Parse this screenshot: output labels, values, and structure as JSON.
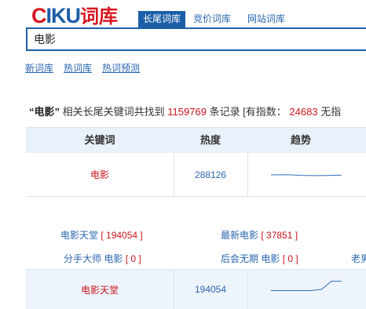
{
  "logo": {
    "c": "C",
    "rest": "IKU",
    "cn": "词库"
  },
  "tabs": [
    {
      "label": "长尾词库",
      "active": true
    },
    {
      "label": "竞价词库",
      "active": false
    },
    {
      "label": "网站词库",
      "active": false
    }
  ],
  "search": {
    "value": "电影"
  },
  "links": [
    "新词库",
    "热词库",
    "热词预测"
  ],
  "summary": {
    "kw": "“电影”",
    "text1": "相关长尾关键词共找到",
    "count": "1159769",
    "text2": "条记录 [有指数：",
    "index": "24683",
    "text3": "无指"
  },
  "table": {
    "headers": [
      "关键词",
      "热度",
      "趋势"
    ],
    "rows": [
      {
        "keyword": "电影",
        "heat": "288126",
        "trend": [
          0.5,
          0.49,
          0.5,
          0.52,
          0.53,
          0.53,
          0.52,
          0.51
        ]
      },
      {
        "keyword": "电影天堂",
        "heat": "194054",
        "trend": [
          0.55,
          0.55,
          0.55,
          0.55,
          0.55,
          0.5,
          0.15,
          0.15
        ]
      }
    ]
  },
  "related": [
    {
      "word": "电影天堂",
      "count": "194054"
    },
    {
      "word": "最新电影",
      "count": "37851"
    },
    {
      "word": "分手大师 电影",
      "count": "0"
    },
    {
      "word": "后会无期 电影",
      "count": "0"
    },
    {
      "word": "老男",
      "count": ""
    }
  ],
  "colors": {
    "brand_red": "#d7161e",
    "brand_blue": "#1c5fa8",
    "link": "#2a66b0",
    "number_red": "#c8161d",
    "header_bg": "#e9f1fa"
  }
}
